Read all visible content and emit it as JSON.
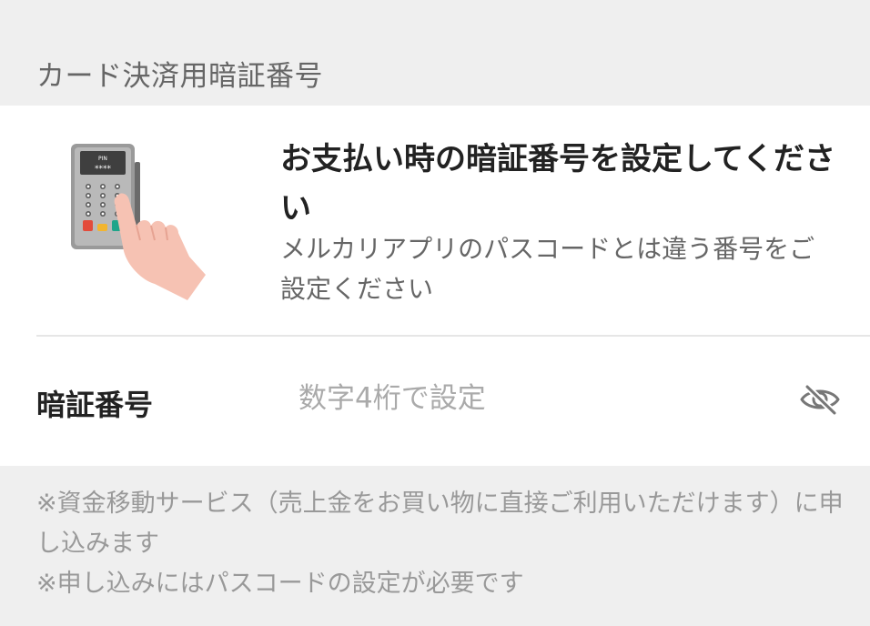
{
  "section": {
    "title": "カード決済用暗証番号"
  },
  "info": {
    "title": "お支払い時の暗証番号を設定してください",
    "subtitle": "メルカリアプリのパスコードとは違う番号をご設定ください",
    "illustration": {
      "icon": "pin-terminal-hand-icon",
      "screen_label": "PIN",
      "screen_mask": "****"
    }
  },
  "pin_field": {
    "label": "暗証番号",
    "value": "",
    "placeholder": "数字4桁で設定",
    "toggle_icon": "eye-off-icon"
  },
  "notes": [
    "※資金移動サービス（売上金をお買い物に直接ご利用いただけます）に申し込みます",
    "※申し込みにはパスコードの設定が必要です"
  ],
  "colors": {
    "background": "#efefef",
    "card": "#ffffff",
    "hand": "#f6c2b3"
  }
}
